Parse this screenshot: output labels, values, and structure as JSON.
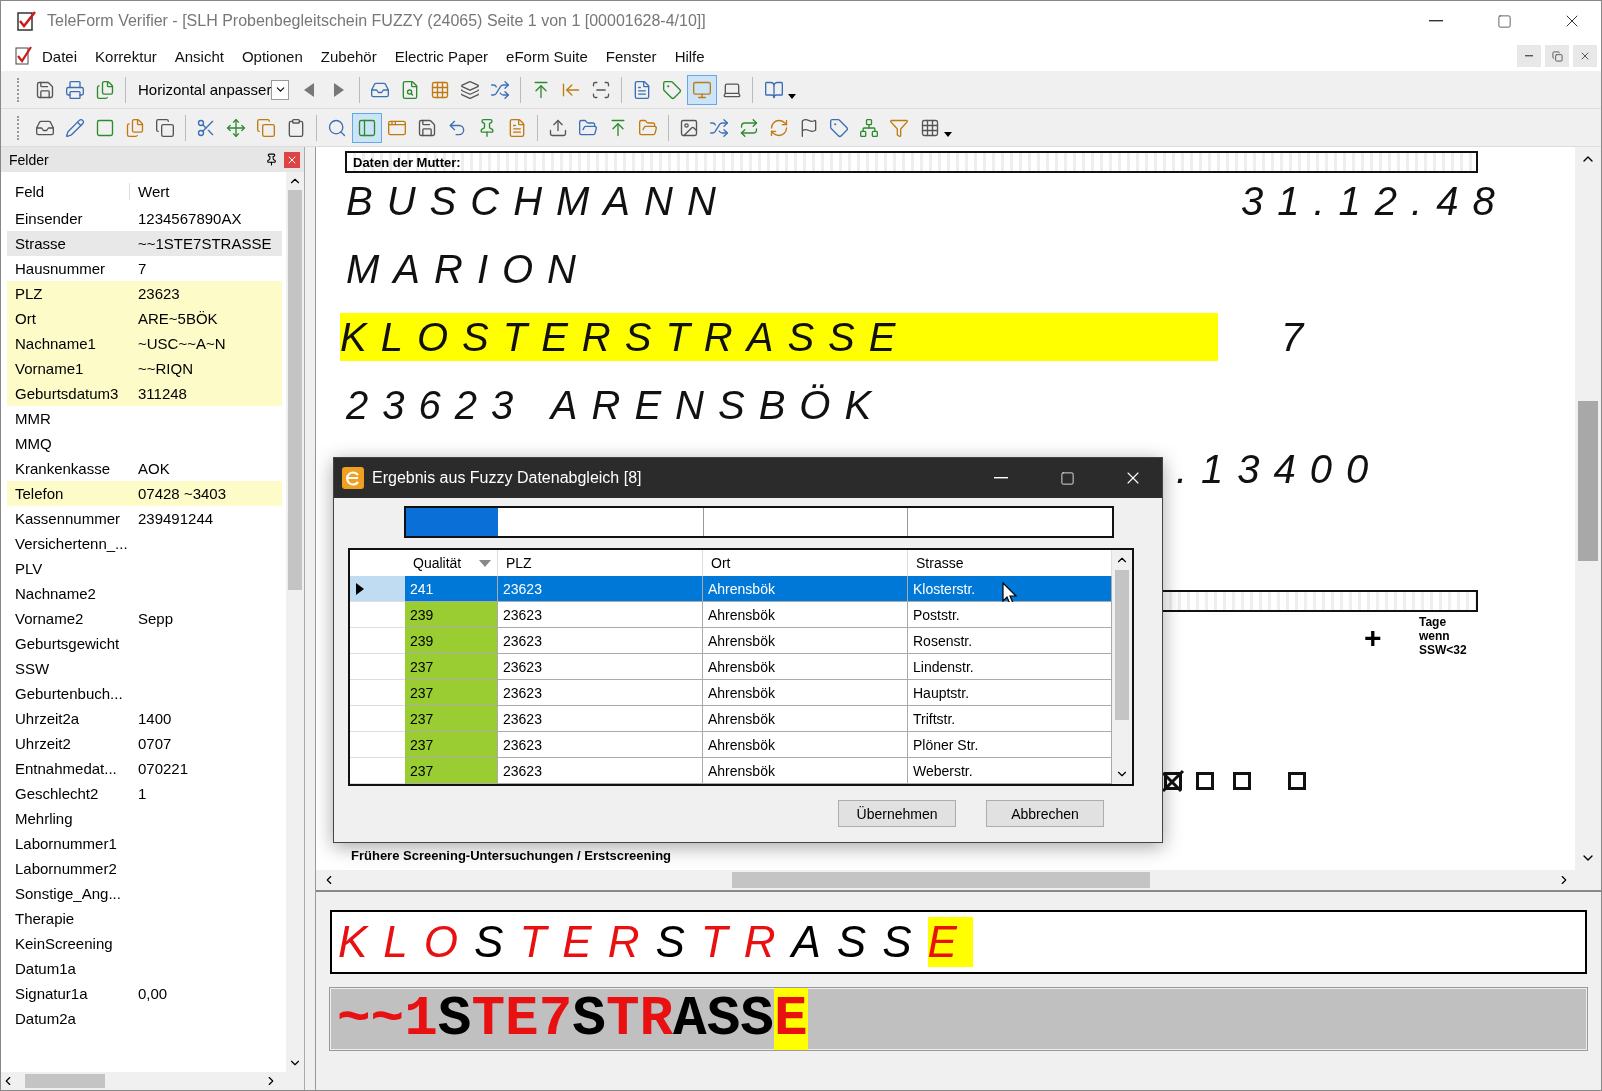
{
  "window": {
    "title": "TeleForm Verifier - [SLH Probenbegleitschein FUZZY (24065) Seite 1 von 1 [00001628-4/10]]"
  },
  "menu": [
    "Datei",
    "Korrektur",
    "Ansicht",
    "Optionen",
    "Zubehör",
    "Electric Paper",
    "eForm Suite",
    "Fenster",
    "Hilfe"
  ],
  "toolbars": [
    [
      {
        "kind": "button",
        "pressed": false
      },
      {
        "kind": "button",
        "pressed": false
      },
      {
        "kind": "button",
        "pressed": false
      },
      {
        "kind": "separator"
      },
      {
        "kind": "combo",
        "value": "Horizontal anpasser"
      },
      {
        "kind": "button",
        "pressed": false
      },
      {
        "kind": "button",
        "pressed": false
      },
      {
        "kind": "separator"
      },
      {
        "kind": "button",
        "pressed": false
      },
      {
        "kind": "button",
        "pressed": false
      },
      {
        "kind": "button",
        "pressed": false
      },
      {
        "kind": "button",
        "pressed": false
      },
      {
        "kind": "button",
        "pressed": false
      },
      {
        "kind": "separator"
      },
      {
        "kind": "button",
        "pressed": false
      },
      {
        "kind": "button",
        "pressed": false
      },
      {
        "kind": "button",
        "pressed": false
      },
      {
        "kind": "separator"
      },
      {
        "kind": "button",
        "pressed": false
      },
      {
        "kind": "button",
        "pressed": false
      },
      {
        "kind": "button",
        "pressed": true
      },
      {
        "kind": "button",
        "pressed": false
      },
      {
        "kind": "separator"
      },
      {
        "kind": "dropdown",
        "pressed": false
      }
    ],
    [
      {
        "kind": "button",
        "pressed": false
      },
      {
        "kind": "button",
        "pressed": false
      },
      {
        "kind": "button",
        "pressed": false
      },
      {
        "kind": "button",
        "pressed": false
      },
      {
        "kind": "button",
        "pressed": false
      },
      {
        "kind": "separator"
      },
      {
        "kind": "button",
        "pressed": false
      },
      {
        "kind": "button",
        "pressed": false
      },
      {
        "kind": "button",
        "pressed": false
      },
      {
        "kind": "button",
        "pressed": false
      },
      {
        "kind": "separator"
      },
      {
        "kind": "button",
        "pressed": false
      },
      {
        "kind": "button",
        "pressed": true
      },
      {
        "kind": "button",
        "pressed": false
      },
      {
        "kind": "button",
        "pressed": false
      },
      {
        "kind": "button",
        "pressed": false
      },
      {
        "kind": "button",
        "pressed": false
      },
      {
        "kind": "button",
        "pressed": false
      },
      {
        "kind": "separator"
      },
      {
        "kind": "button",
        "pressed": false
      },
      {
        "kind": "button",
        "pressed": false
      },
      {
        "kind": "button",
        "pressed": false
      },
      {
        "kind": "button",
        "pressed": false
      },
      {
        "kind": "separator"
      },
      {
        "kind": "button",
        "pressed": false
      },
      {
        "kind": "button",
        "pressed": false
      },
      {
        "kind": "button",
        "pressed": false
      },
      {
        "kind": "button",
        "pressed": false
      },
      {
        "kind": "button",
        "pressed": false
      },
      {
        "kind": "button",
        "pressed": false
      },
      {
        "kind": "button",
        "pressed": false
      },
      {
        "kind": "button",
        "pressed": false
      },
      {
        "kind": "dropdown",
        "pressed": false
      }
    ]
  ],
  "fields_panel": {
    "title": "Felder",
    "columns": [
      "Feld",
      "Wert"
    ],
    "rows": [
      {
        "field": "Einsender",
        "value": "1234567890AX",
        "selected": false,
        "flagged": false
      },
      {
        "field": "Strasse",
        "value": "~~1STE7STRASSE",
        "selected": true,
        "flagged": false
      },
      {
        "field": "Hausnummer",
        "value": "7",
        "selected": false,
        "flagged": false
      },
      {
        "field": "PLZ",
        "value": "23623",
        "selected": false,
        "flagged": true
      },
      {
        "field": "Ort",
        "value": "ARE~5BÖK",
        "selected": false,
        "flagged": true
      },
      {
        "field": "Nachname1",
        "value": "~USC~~A~N",
        "selected": false,
        "flagged": true
      },
      {
        "field": "Vorname1",
        "value": "~~RIQN",
        "selected": false,
        "flagged": true
      },
      {
        "field": "Geburtsdatum3",
        "value": "311248",
        "selected": false,
        "flagged": true
      },
      {
        "field": "MMR",
        "selected": false,
        "flagged": false
      },
      {
        "field": "MMQ",
        "selected": false,
        "flagged": false
      },
      {
        "field": "Krankenkasse",
        "value": "AOK",
        "selected": false,
        "flagged": false
      },
      {
        "field": "Telefon",
        "value": "07428 ~3403",
        "selected": false,
        "flagged": true
      },
      {
        "field": "Kassennummer",
        "value": "239491244",
        "selected": false,
        "flagged": false
      },
      {
        "field": "Versichertenn_...",
        "selected": false,
        "flagged": false
      },
      {
        "field": "PLV",
        "selected": false,
        "flagged": false
      },
      {
        "field": "Nachname2",
        "selected": false,
        "flagged": false
      },
      {
        "field": "Vorname2",
        "value": "Sepp",
        "selected": false,
        "flagged": false
      },
      {
        "field": "Geburtsgewicht",
        "selected": false,
        "flagged": false
      },
      {
        "field": "SSW",
        "selected": false,
        "flagged": false
      },
      {
        "field": "Geburtenbuch...",
        "selected": false,
        "flagged": false
      },
      {
        "field": "Uhrzeit2a",
        "value": "1400",
        "selected": false,
        "flagged": false
      },
      {
        "field": "Uhrzeit2",
        "value": "0707",
        "selected": false,
        "flagged": false
      },
      {
        "field": "Entnahmedat...",
        "value": "070221",
        "selected": false,
        "flagged": false
      },
      {
        "field": "Geschlecht2",
        "value": "1",
        "selected": false,
        "flagged": false
      },
      {
        "field": "Mehrling",
        "selected": false,
        "flagged": false
      },
      {
        "field": "Labornummer1",
        "selected": false,
        "flagged": false
      },
      {
        "field": "Labornummer2",
        "selected": false,
        "flagged": false
      },
      {
        "field": "Sonstige_Ang...",
        "selected": false,
        "flagged": false
      },
      {
        "field": "Therapie",
        "selected": false,
        "flagged": false
      },
      {
        "field": "KeinScreening",
        "selected": false,
        "flagged": false
      },
      {
        "field": "Datum1a",
        "selected": false,
        "flagged": false
      },
      {
        "field": "Signatur1a",
        "value": "0,00",
        "selected": false,
        "flagged": false
      },
      {
        "field": "Datum2a",
        "selected": false,
        "flagged": false
      }
    ]
  },
  "document": {
    "section_heading": "Daten der Mutter:",
    "handwriting": [
      {
        "text": "BUSCHMANN",
        "highlighted": false
      },
      {
        "text": "31.12.48",
        "highlighted": false
      },
      {
        "text": "MARION",
        "highlighted": false
      },
      {
        "text": "KLOSTERSTRASSE",
        "highlighted": true
      },
      {
        "text": "7",
        "highlighted": false
      },
      {
        "text": "23623 ARENSBÖK",
        "highlighted": false
      },
      {
        "text": ".13400",
        "highlighted": false
      }
    ],
    "plus_mark": "+",
    "side_note": [
      "Tage",
      "wenn",
      "SSW<32"
    ],
    "checkboxes": [
      {
        "checked": true
      },
      {
        "checked": false
      },
      {
        "checked": false
      },
      {
        "checked": false
      }
    ],
    "footer_heading": "Frühere Screening-Untersuchungen / Erstscreening"
  },
  "dialog": {
    "title": "Ergebnis aus Fuzzy Datenabgleich [8]",
    "progress": {
      "level": 0.13
    },
    "columns": [
      "Qualität",
      "PLZ",
      "Ort",
      "Strasse"
    ],
    "rows": [
      {
        "cells": [
          "241",
          "23623",
          "Ahrensbök",
          "Klosterstr."
        ],
        "selected": true
      },
      {
        "cells": [
          "239",
          "23623",
          "Ahrensbök",
          "Poststr."
        ],
        "selected": false
      },
      {
        "cells": [
          "239",
          "23623",
          "Ahrensbök",
          "Rosenstr."
        ],
        "selected": false
      },
      {
        "cells": [
          "237",
          "23623",
          "Ahrensbök",
          "Lindenstr."
        ],
        "selected": false
      },
      {
        "cells": [
          "237",
          "23623",
          "Ahrensbök",
          "Hauptstr."
        ],
        "selected": false
      },
      {
        "cells": [
          "237",
          "23623",
          "Ahrensbök",
          "Triftstr."
        ],
        "selected": false
      },
      {
        "cells": [
          "237",
          "23623",
          "Ahrensbök",
          "Plöner Str."
        ],
        "selected": false
      },
      {
        "cells": [
          "237",
          "23623",
          "Ahrensbök",
          "Weberstr."
        ],
        "selected": false
      }
    ],
    "buttons": [
      "Übernehmen",
      "Abbrechen"
    ]
  },
  "correction": {
    "snippet": [
      {
        "char": "K",
        "flagged": true,
        "current": false
      },
      {
        "char": "L",
        "flagged": true,
        "current": false
      },
      {
        "char": "O",
        "flagged": true,
        "current": false
      },
      {
        "char": "S",
        "flagged": false,
        "current": false
      },
      {
        "char": "T",
        "flagged": true,
        "current": false
      },
      {
        "char": "E",
        "flagged": true,
        "current": false
      },
      {
        "char": "R",
        "flagged": true,
        "current": false
      },
      {
        "char": "S",
        "flagged": false,
        "current": false
      },
      {
        "char": "T",
        "flagged": true,
        "current": false
      },
      {
        "char": "R",
        "flagged": true,
        "current": false
      },
      {
        "char": "A",
        "flagged": false,
        "current": false
      },
      {
        "char": "S",
        "flagged": false,
        "current": false
      },
      {
        "char": "S",
        "flagged": false,
        "current": false
      },
      {
        "char": "E",
        "flagged": true,
        "current": true
      }
    ],
    "recognized": [
      {
        "char": "~",
        "flagged": true,
        "current": false
      },
      {
        "char": "~",
        "flagged": true,
        "current": false
      },
      {
        "char": "1",
        "flagged": true,
        "current": false
      },
      {
        "char": "S",
        "flagged": false,
        "current": false
      },
      {
        "char": "T",
        "flagged": true,
        "current": false
      },
      {
        "char": "E",
        "flagged": true,
        "current": false
      },
      {
        "char": "7",
        "flagged": true,
        "current": false
      },
      {
        "char": "S",
        "flagged": false,
        "current": false
      },
      {
        "char": "T",
        "flagged": true,
        "current": false
      },
      {
        "char": "R",
        "flagged": true,
        "current": false
      },
      {
        "char": "A",
        "flagged": false,
        "current": false
      },
      {
        "char": "S",
        "flagged": false,
        "current": false
      },
      {
        "char": "S",
        "flagged": false,
        "current": false
      },
      {
        "char": "E",
        "flagged": true,
        "current": true
      }
    ]
  }
}
